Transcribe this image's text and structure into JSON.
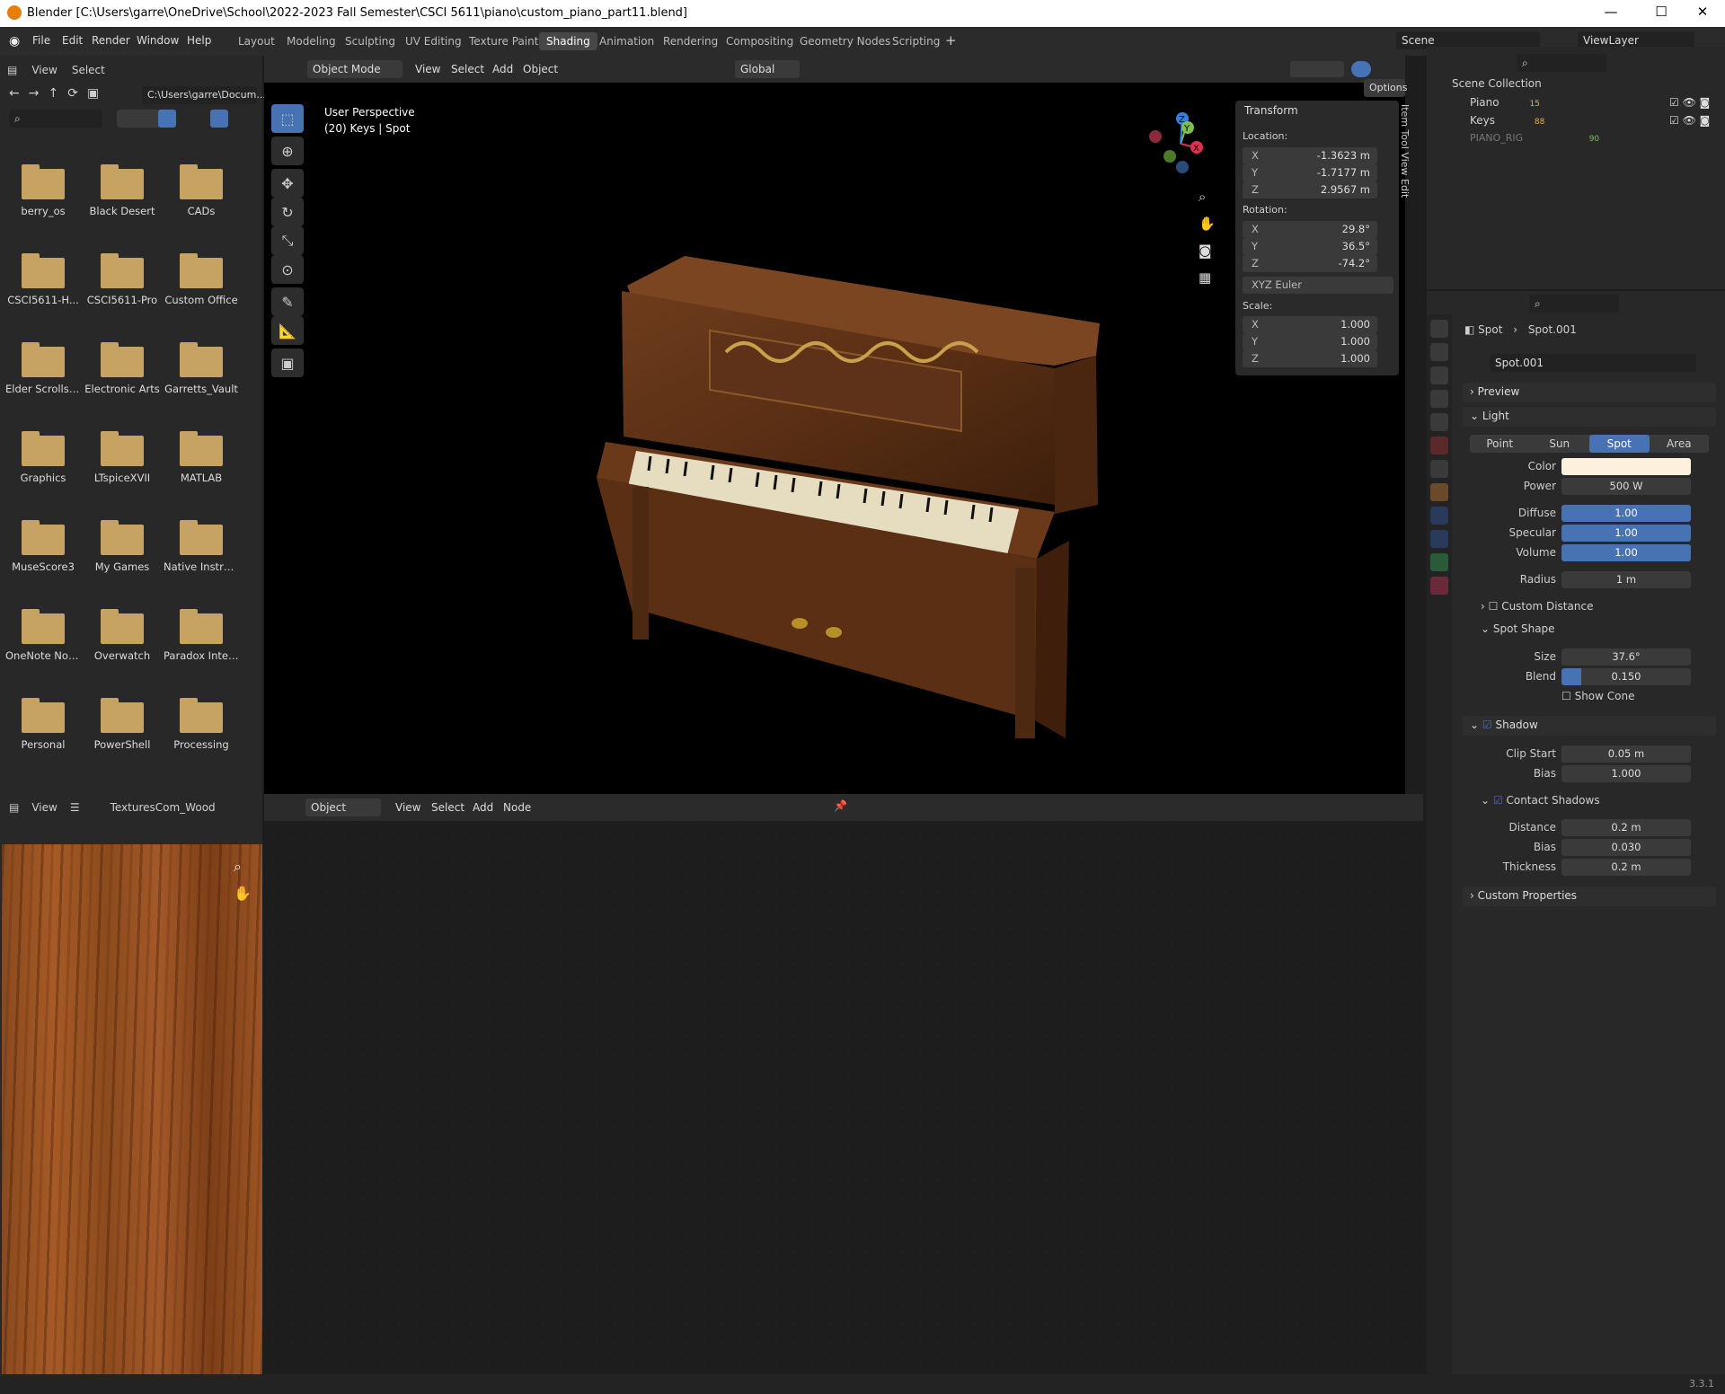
{
  "window": {
    "title": "Blender [C:\\Users\\garre\\OneDrive\\School\\2022-2023 Fall Semester\\CSCI 5611\\piano\\custom_piano_part11.blend]"
  },
  "menu": [
    "File",
    "Edit",
    "Render",
    "Window",
    "Help"
  ],
  "workspaces": [
    "Layout",
    "Modeling",
    "Sculpting",
    "UV Editing",
    "Texture Paint",
    "Shading",
    "Animation",
    "Rendering",
    "Compositing",
    "Geometry Nodes",
    "Scripting"
  ],
  "active_workspace": "Shading",
  "scene": "Scene",
  "viewlayer": "ViewLayer",
  "filebrowser": {
    "menu": [
      "View",
      "Select"
    ],
    "path": "C:\\Users\\garre\\Docum...",
    "folders": [
      "berry_os",
      "Black Desert",
      "CADs",
      "CSCI5611-H...",
      "CSCI5611-Pro",
      "Custom Office",
      "Elder Scrolls ...",
      "Electronic Arts",
      "Garretts_Vault",
      "Graphics",
      "LTspiceXVII",
      "MATLAB",
      "MuseScore3",
      "My Games",
      "Native Instru...",
      "OneNote Not...",
      "Overwatch",
      "Paradox Inter...",
      "Personal",
      "PowerShell",
      "Processing"
    ]
  },
  "viewport": {
    "mode": "Object Mode",
    "menu": [
      "View",
      "Select",
      "Add",
      "Object"
    ],
    "orientation": "Global",
    "options": "Options",
    "info_line1": "User Perspective",
    "info_line2": "(20) Keys | Spot",
    "side_tabs": [
      "Item",
      "Tool",
      "View",
      "Edit"
    ]
  },
  "transform": {
    "title": "Transform",
    "location_label": "Location:",
    "location": [
      {
        "ax": "X",
        "v": "-1.3623 m"
      },
      {
        "ax": "Y",
        "v": "-1.7177 m"
      },
      {
        "ax": "Z",
        "v": "2.9567 m"
      }
    ],
    "rotation_label": "Rotation:",
    "rotation": [
      {
        "ax": "X",
        "v": "29.8°"
      },
      {
        "ax": "Y",
        "v": "36.5°"
      },
      {
        "ax": "Z",
        "v": "-74.2°"
      }
    ],
    "rotation_mode": "XYZ Euler",
    "scale_label": "Scale:",
    "scale": [
      {
        "ax": "X",
        "v": "1.000"
      },
      {
        "ax": "Y",
        "v": "1.000"
      },
      {
        "ax": "Z",
        "v": "1.000"
      }
    ]
  },
  "image_editor": {
    "view": "View",
    "image": "TexturesCom_Wood"
  },
  "node_editor": {
    "type": "Object",
    "menu": [
      "View",
      "Select",
      "Add",
      "Node"
    ]
  },
  "outliner": {
    "root": "Scene Collection",
    "items": [
      {
        "name": "Piano",
        "badge": "15"
      },
      {
        "name": "Keys",
        "badge": "88"
      },
      {
        "name": "PIANO_RIG",
        "badge": "90"
      }
    ]
  },
  "properties": {
    "breadcrumb_obj": "Spot",
    "breadcrumb_data": "Spot.001",
    "datablock": "Spot.001",
    "preview": "Preview",
    "light": "Light",
    "light_types": [
      "Point",
      "Sun",
      "Spot",
      "Area"
    ],
    "active_light_type": "Spot",
    "color_label": "Color",
    "power_label": "Power",
    "power": "500 W",
    "diffuse_label": "Diffuse",
    "diffuse": "1.00",
    "specular_label": "Specular",
    "specular": "1.00",
    "volume_label": "Volume",
    "volume": "1.00",
    "radius_label": "Radius",
    "radius": "1 m",
    "custom_distance": "Custom Distance",
    "spot_shape": "Spot Shape",
    "size_label": "Size",
    "size": "37.6°",
    "blend_label": "Blend",
    "blend": "0.150",
    "blend_fraction": 0.15,
    "show_cone": "Show Cone",
    "shadow": "Shadow",
    "clip_start_label": "Clip Start",
    "clip_start": "0.05 m",
    "bias_label": "Bias",
    "bias": "1.000",
    "contact_shadows": "Contact Shadows",
    "distance_label": "Distance",
    "distance": "0.2 m",
    "cbias_label": "Bias",
    "cbias": "0.030",
    "thickness_label": "Thickness",
    "thickness": "0.2 m",
    "custom_properties": "Custom Properties"
  },
  "status": {
    "version": "3.3.1"
  },
  "colors": {
    "accent": "#4772b3",
    "light_color": "#fdf0dc"
  }
}
